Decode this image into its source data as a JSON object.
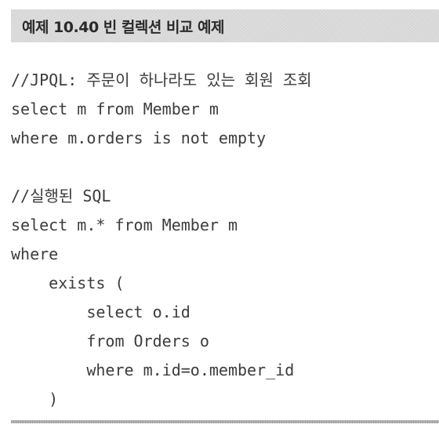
{
  "caption": "예제 10.40 빈 컬렉션 비교 예제",
  "code_lines": [
    "//JPQL: 주문이 하나라도 있는 회원 조회",
    "select m from Member m",
    "where m.orders is not empty",
    "",
    "//실행된 SQL",
    "select m.* from Member m",
    "where",
    "    exists (",
    "        select o.id",
    "        from Orders o",
    "        where m.id=o.member_id",
    "    )"
  ],
  "colors": {
    "caption_background": "#dadada",
    "caption_text": "#2a2a2a",
    "code_text": "#3c3c3c",
    "rule": "#b4b4b4"
  }
}
